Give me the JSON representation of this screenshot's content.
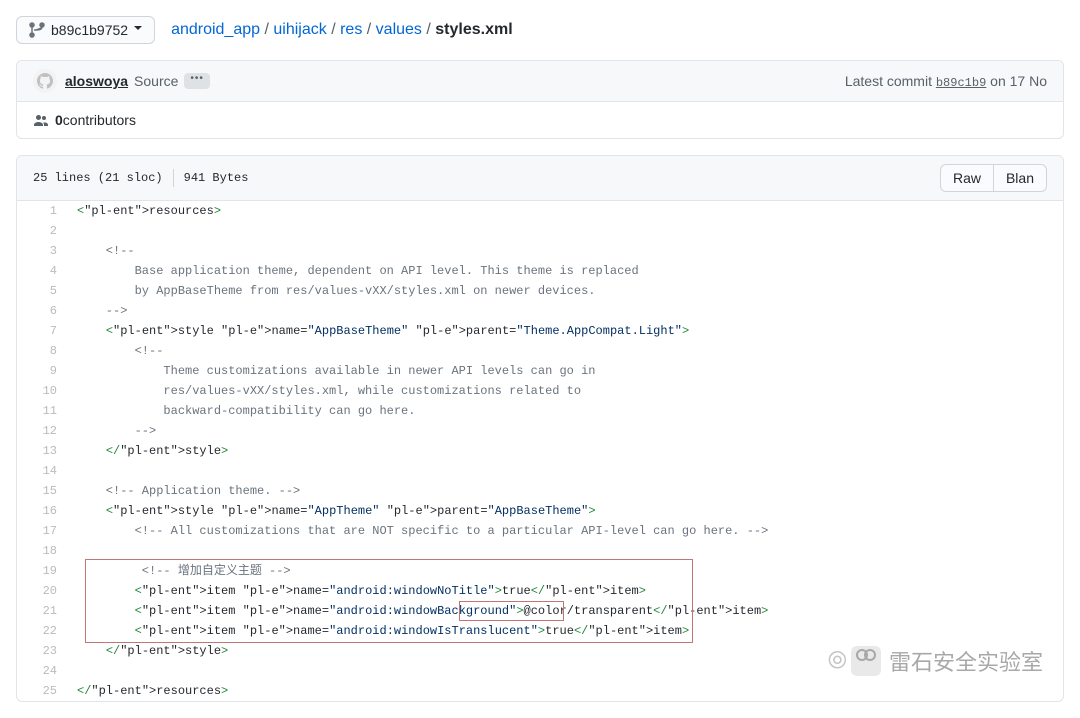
{
  "branch": "b89c1b9752",
  "breadcrumb": {
    "parts": [
      "android_app",
      "uihijack",
      "res",
      "values"
    ],
    "file": "styles.xml"
  },
  "commit": {
    "author": "aloswoya",
    "message": "Source",
    "latest_prefix": "Latest commit ",
    "sha": "b89c1b9",
    "date_prefix": " on ",
    "date": "17 No"
  },
  "contributors": {
    "count": "0",
    "label": " contributors"
  },
  "file_info": {
    "lines": "25 lines (21 sloc)",
    "bytes": "941 Bytes",
    "raw_label": "Raw",
    "blame_label": "Blan"
  },
  "code": [
    {
      "n": 1,
      "t": "tag",
      "raw": "<resources>"
    },
    {
      "n": 2,
      "t": "blank",
      "raw": ""
    },
    {
      "n": 3,
      "t": "c",
      "raw": "    <!--"
    },
    {
      "n": 4,
      "t": "c",
      "raw": "        Base application theme, dependent on API level. This theme is replaced"
    },
    {
      "n": 5,
      "t": "c",
      "raw": "        by AppBaseTheme from res/values-vXX/styles.xml on newer devices."
    },
    {
      "n": 6,
      "t": "c",
      "raw": "    -->"
    },
    {
      "n": 7,
      "t": "style",
      "raw": "    <style name=\"AppBaseTheme\" parent=\"Theme.AppCompat.Light\">"
    },
    {
      "n": 8,
      "t": "c",
      "raw": "        <!--"
    },
    {
      "n": 9,
      "t": "c",
      "raw": "            Theme customizations available in newer API levels can go in"
    },
    {
      "n": 10,
      "t": "c",
      "raw": "            res/values-vXX/styles.xml, while customizations related to"
    },
    {
      "n": 11,
      "t": "c",
      "raw": "            backward-compatibility can go here."
    },
    {
      "n": 12,
      "t": "c",
      "raw": "        -->"
    },
    {
      "n": 13,
      "t": "tag",
      "raw": "    </style>"
    },
    {
      "n": 14,
      "t": "blank",
      "raw": ""
    },
    {
      "n": 15,
      "t": "c",
      "raw": "    <!-- Application theme. -->"
    },
    {
      "n": 16,
      "t": "style",
      "raw": "    <style name=\"AppTheme\" parent=\"AppBaseTheme\">"
    },
    {
      "n": 17,
      "t": "c",
      "raw": "        <!-- All customizations that are NOT specific to a particular API-level can go here. -->"
    },
    {
      "n": 18,
      "t": "blank",
      "raw": ""
    },
    {
      "n": 19,
      "t": "c",
      "raw": "         <!-- 增加自定义主题 -->"
    },
    {
      "n": 20,
      "t": "item",
      "raw": "        <item name=\"android:windowNoTitle\">true</item>"
    },
    {
      "n": 21,
      "t": "item",
      "raw": "        <item name=\"android:windowBackground\">@color/transparent</item>"
    },
    {
      "n": 22,
      "t": "item",
      "raw": "        <item name=\"android:windowIsTranslucent\">true</item>"
    },
    {
      "n": 23,
      "t": "tag",
      "raw": "    </style>"
    },
    {
      "n": 24,
      "t": "blank",
      "raw": ""
    },
    {
      "n": 25,
      "t": "tag",
      "raw": "</resources>"
    }
  ],
  "watermark": "雷石安全实验室"
}
